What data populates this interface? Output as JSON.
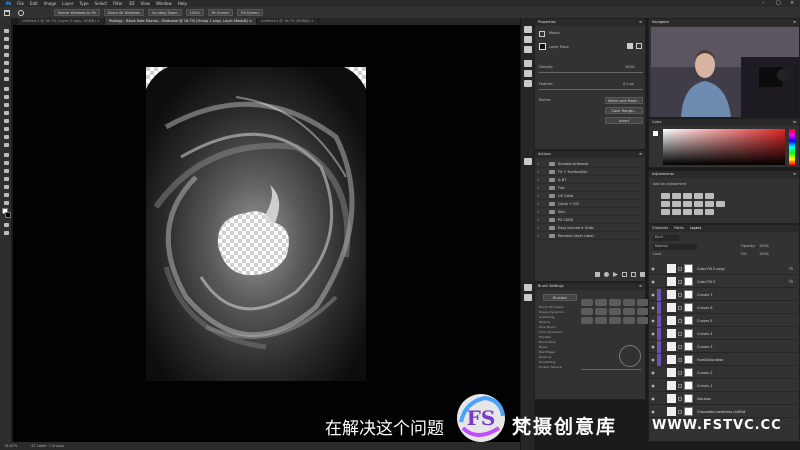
{
  "menubar": {
    "items": [
      "Ps",
      "File",
      "Edit",
      "Image",
      "Layer",
      "Type",
      "Select",
      "Filter",
      "3D",
      "View",
      "Window",
      "Help"
    ],
    "window_controls": [
      "–",
      "□",
      "×"
    ]
  },
  "options": {
    "buttons": [
      "Resize Windows to Fit",
      "Zoom All Windows",
      "Scrubby Zoom",
      "100%",
      "Fit Screen",
      "Fill Screen"
    ]
  },
  "tabs": [
    {
      "label": "Untitled-1 @ 16.7% (Layer 0 copy, RGB/8) ×",
      "active": false
    },
    {
      "label": "Phology - Black Hole Macros - Mudroom @ 16.7% (Group 1 copy, Layer Mask/8) ×",
      "active": true
    },
    {
      "label": "Untitled-4 @ 16.7% (RGB/8) ×",
      "active": false
    }
  ],
  "status": {
    "zoom": "16.67%",
    "info": "ST Label: ? Groups"
  },
  "properties": {
    "title": "Properties",
    "masks_label": "Masks",
    "layer_mask_label": "Layer Mask",
    "density_label": "Density:",
    "density_value": "100%",
    "feather_label": "Feather:",
    "feather_value": "0.0 px",
    "refine_label": "Refine:",
    "select_mask_button": "Select and Mask...",
    "color_range_button": "Color Range...",
    "invert_button": "Invert"
  },
  "actions": {
    "title": "Actions",
    "rows": [
      "Shadow Artboard",
      "FX + Surface/Nu",
      "A-NT",
      "Flat",
      "UX Grids",
      "Clone + Gill",
      "Skin",
      "PS CXNS",
      "Easy Isometric Grids",
      "Remove Layer Label"
    ]
  },
  "brush": {
    "title": "Brush Settings",
    "brushes_button": "Brushes",
    "options": [
      "Brush Tip Shape",
      "Shape Dynamics",
      "Scattering",
      "Texture",
      "Dual Brush",
      "Color Dynamics",
      "Transfer",
      "Brush Pose",
      "Noise",
      "Wet Edges",
      "Build-up",
      "Smoothing",
      "Protect Texture"
    ]
  },
  "navigator": {
    "title": "Navigator"
  },
  "color": {
    "title": "Color"
  },
  "adjustments": {
    "title": "Adjustments",
    "subtitle": "Add an adjustment"
  },
  "layers": {
    "tabs": [
      "Channels",
      "Paths",
      "Layers"
    ],
    "kind": "Kind",
    "blend": "Normal",
    "opacity_label": "Opacity:",
    "opacity_value": "100%",
    "lock_label": "Lock:",
    "fill_label": "Fill:",
    "fill_value": "100%",
    "rows": [
      {
        "name": "Color Fill 2 copy",
        "clip": false,
        "fx": true
      },
      {
        "name": "Color Fill 2",
        "clip": false,
        "fx": true
      },
      {
        "name": "Curves 7",
        "clip": true,
        "fx": false
      },
      {
        "name": "Curves 6",
        "clip": true,
        "fx": false
      },
      {
        "name": "Curves 5",
        "clip": true,
        "fx": false
      },
      {
        "name": "Curves 4",
        "clip": true,
        "fx": false
      },
      {
        "name": "Curves 3",
        "clip": true,
        "fx": false
      },
      {
        "name": "Hue/Saturation",
        "clip": true,
        "fx": false
      },
      {
        "name": "Curves 2",
        "clip": false,
        "fx": false
      },
      {
        "name": "Curves 1",
        "clip": false,
        "fx": false
      },
      {
        "name": "Solution",
        "clip": false,
        "fx": false
      },
      {
        "name": "Chocolate-swatches-UnB0#",
        "clip": false,
        "fx": false
      }
    ]
  },
  "overlay": {
    "subtitle": "在解决这个问题",
    "watermark_logo": "FS",
    "watermark_text": "梵摄创意库",
    "watermark_url": "WWW.FSTVC.CC"
  },
  "colors": {
    "accent_purple": "#6b4fb2",
    "picker_red": "#e02525"
  }
}
